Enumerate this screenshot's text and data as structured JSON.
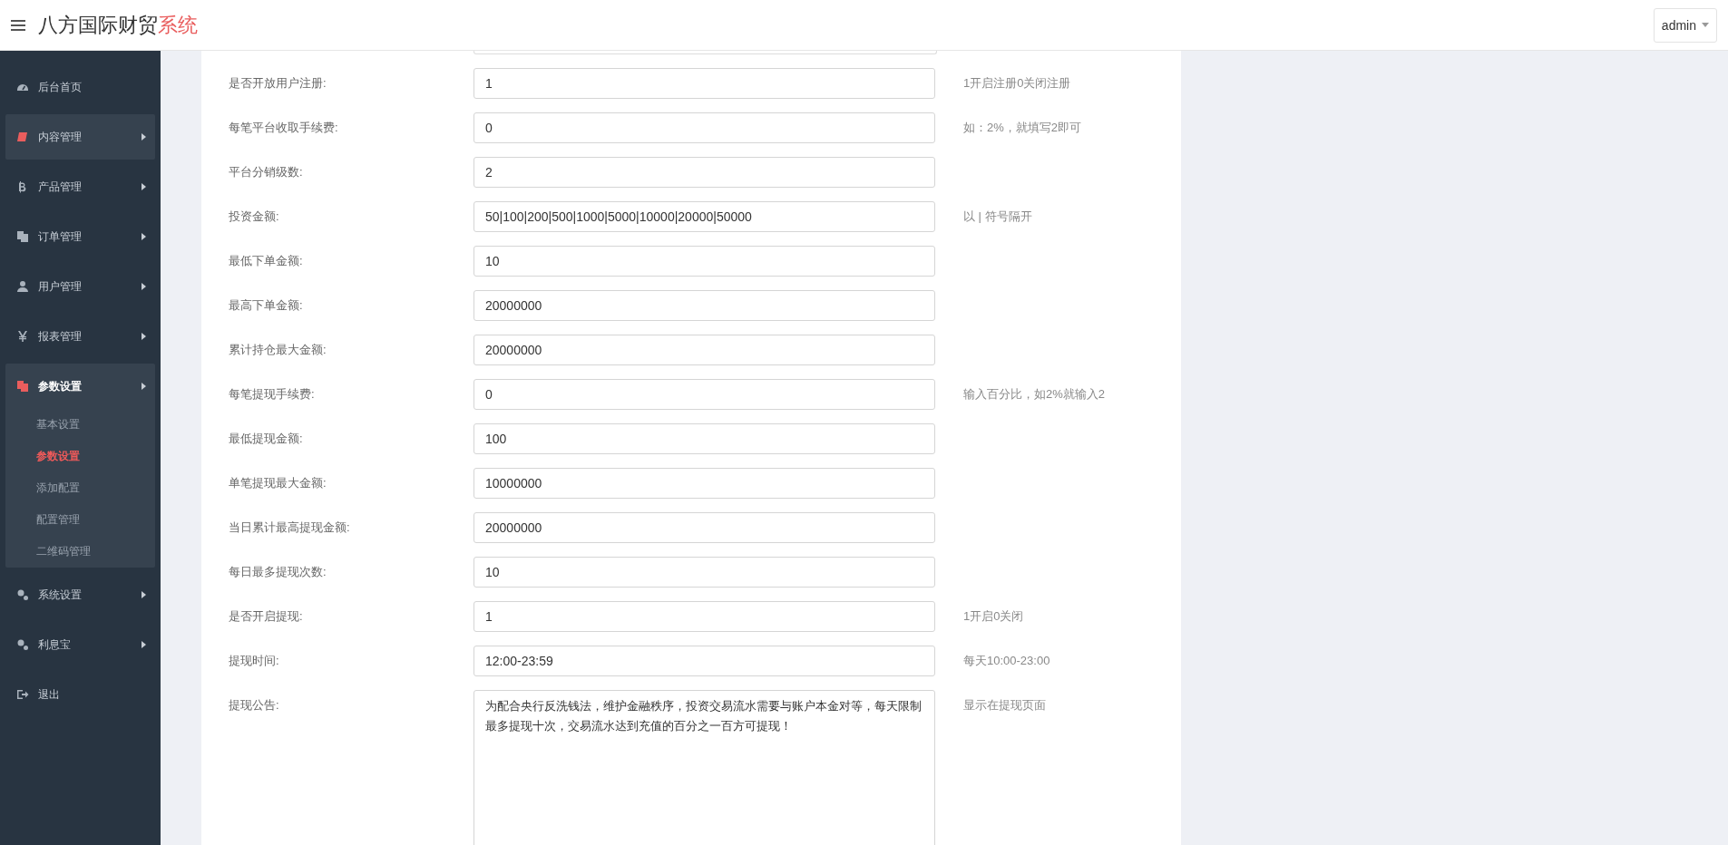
{
  "header": {
    "title": "八方国际财贸",
    "title_accent": "系统",
    "user": "admin"
  },
  "sidebar": {
    "items": [
      {
        "label": "后台首页",
        "kind": "link",
        "highlighted": false,
        "expanded": false
      },
      {
        "label": "内容管理",
        "kind": "menu",
        "highlighted": true,
        "expanded": false
      },
      {
        "label": "产品管理",
        "kind": "menu",
        "highlighted": false,
        "expanded": false
      },
      {
        "label": "订单管理",
        "kind": "menu",
        "highlighted": false,
        "expanded": false
      },
      {
        "label": "用户管理",
        "kind": "menu",
        "highlighted": false,
        "expanded": false
      },
      {
        "label": "报表管理",
        "kind": "menu",
        "highlighted": false,
        "expanded": false
      },
      {
        "label": "参数设置",
        "kind": "menu",
        "highlighted": false,
        "expanded": true,
        "children": [
          {
            "label": "基本设置",
            "selected": false
          },
          {
            "label": "参数设置",
            "selected": true
          },
          {
            "label": "添加配置",
            "selected": false
          },
          {
            "label": "配置管理",
            "selected": false
          },
          {
            "label": "二维码管理",
            "selected": false
          }
        ]
      },
      {
        "label": "系统设置",
        "kind": "menu",
        "highlighted": false,
        "expanded": false
      },
      {
        "label": "利息宝",
        "kind": "menu",
        "highlighted": false,
        "expanded": false
      },
      {
        "label": "退出",
        "kind": "link",
        "highlighted": false,
        "expanded": false
      }
    ]
  },
  "form": {
    "rows": [
      {
        "label": "是否开放用户注册:",
        "value": "1",
        "hint": "1开启注册0关闭注册",
        "kind": "input"
      },
      {
        "label": "每笔平台收取手续费:",
        "value": "0",
        "hint": "如：2%，就填写2即可",
        "kind": "input"
      },
      {
        "label": "平台分销级数:",
        "value": "2",
        "kind": "input"
      },
      {
        "label": "投资金额:",
        "value": "50|100|200|500|1000|5000|10000|20000|50000",
        "hint": "以 | 符号隔开",
        "kind": "input"
      },
      {
        "label": "最低下单金额:",
        "value": "10",
        "kind": "input"
      },
      {
        "label": "最高下单金额:",
        "value": "20000000",
        "kind": "input"
      },
      {
        "label": "累计持仓最大金额:",
        "value": "20000000",
        "kind": "input"
      },
      {
        "label": "每笔提现手续费:",
        "value": "0",
        "hint": "输入百分比，如2%就输入2",
        "kind": "input"
      },
      {
        "label": "最低提现金额:",
        "value": "100",
        "kind": "input"
      },
      {
        "label": "单笔提现最大金额:",
        "value": "10000000",
        "kind": "input"
      },
      {
        "label": "当日累计最高提现金额:",
        "value": "20000000",
        "kind": "input"
      },
      {
        "label": "每日最多提现次数:",
        "value": "10",
        "kind": "input"
      },
      {
        "label": "是否开启提现:",
        "value": "1",
        "hint": "1开启0关闭",
        "kind": "input"
      },
      {
        "label": "提现时间:",
        "value": "12:00-23:59",
        "hint": "每天10:00-23:00",
        "kind": "input"
      },
      {
        "label": "提现公告:",
        "value": "为配合央行反洗钱法，维护金融秩序，投资交易流水需要与账户本金对等，每天限制最多提现十次，交易流水达到充值的百分之一百方可提现！",
        "hint": "显示在提现页面",
        "kind": "textarea"
      }
    ]
  }
}
